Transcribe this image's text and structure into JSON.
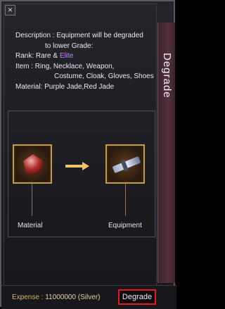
{
  "window": {
    "title": "Degrade",
    "close_glyph": "×"
  },
  "description": {
    "line1": "Description : Equipment will be degraded",
    "line2": "to lower Grade:",
    "rank_label": "Rank:",
    "rank_value": "Rare &",
    "rank_elite": "Elite",
    "item_label": "Item :",
    "item_value_1": "Ring, Necklace, Weapon,",
    "item_value_2": "Costume, Cloak, Gloves, Shoes",
    "material_label": "Material:",
    "material_value": "Purple Jade,Red Jade"
  },
  "slots": {
    "material_label": "Material",
    "equipment_label": "Equipment",
    "material_icon": "red-jade-gem-icon",
    "equipment_icon": "sword-weapon-icon"
  },
  "footer": {
    "expense_label": "Expense : ",
    "expense_value": "11000000 (Silver)",
    "button_label": "Degrade"
  },
  "colors": {
    "elite": "#c989ff",
    "button_highlight": "#e11d1d",
    "slot_border": "#c09b4a",
    "arrow": "#f3c36a"
  }
}
